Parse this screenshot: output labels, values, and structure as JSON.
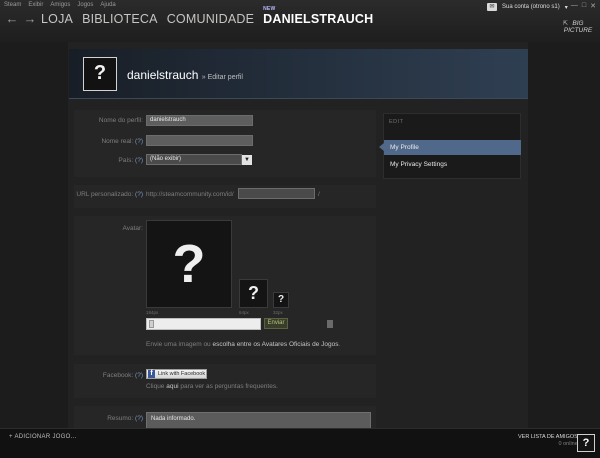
{
  "menubar": [
    "Steam",
    "Exibir",
    "Amigos",
    "Jogos",
    "Ajuda"
  ],
  "nav": {
    "back_icon": "arrow-left-icon",
    "forward_icon": "arrow-right-icon",
    "tabs": [
      "LOJA",
      "BIBLIOTECA",
      "COMUNIDADE"
    ],
    "active_tab": "DANIELSTRAUCH",
    "active_tab_badge": "NEW"
  },
  "account": {
    "label": "Sua conta (otrono s1)",
    "mail_icon": "envelope-icon"
  },
  "big_picture": {
    "line1": "BIG",
    "line2": "PICTURE"
  },
  "profile": {
    "avatar_placeholder": "?",
    "name": "danielstrauch",
    "subtitle": "» Editar perfil"
  },
  "form": {
    "nome_perfil_label": "Nome do perfil:",
    "nome_perfil_value": "danielstrauch",
    "nome_real_label": "Nome real:",
    "help": "(?)",
    "pais_label": "País:",
    "pais_value": "(Não exibir)",
    "url_label": "URL personalizado:",
    "url_prefix": "http://steamcommunity.com/id/",
    "url_suffix": "/",
    "avatar_label": "Avatar:",
    "avatar_q": "?",
    "size_184": "184px",
    "size_64": "64px",
    "size_32": "32px",
    "enviar": "Enviar",
    "upload_text_1": "Envie uma imagem ou ",
    "upload_link": "escolha entre os Avatares Oficiais de Jogos",
    "upload_text_2": ".",
    "facebook_label": "Facebook:",
    "facebook_btn": "Link with Facebook",
    "facebook_help_1": "Clique ",
    "facebook_help_link": "aqui",
    "facebook_help_2": " para ver as perguntas frequentes.",
    "resumo_label": "Resumo:",
    "resumo_value": "Nada informado."
  },
  "side_nav": {
    "title": "EDIT",
    "items": [
      "My Profile",
      "My Privacy Settings"
    ]
  },
  "bottom": {
    "add_game": "+ ADICIONAR JOGO...",
    "friends": "VER LISTA DE AMIGOS",
    "friends_sub": "0 online",
    "friend_avatar": "?"
  },
  "colors": {
    "accent": "#50698a",
    "header_blue": "#2f3f52"
  }
}
